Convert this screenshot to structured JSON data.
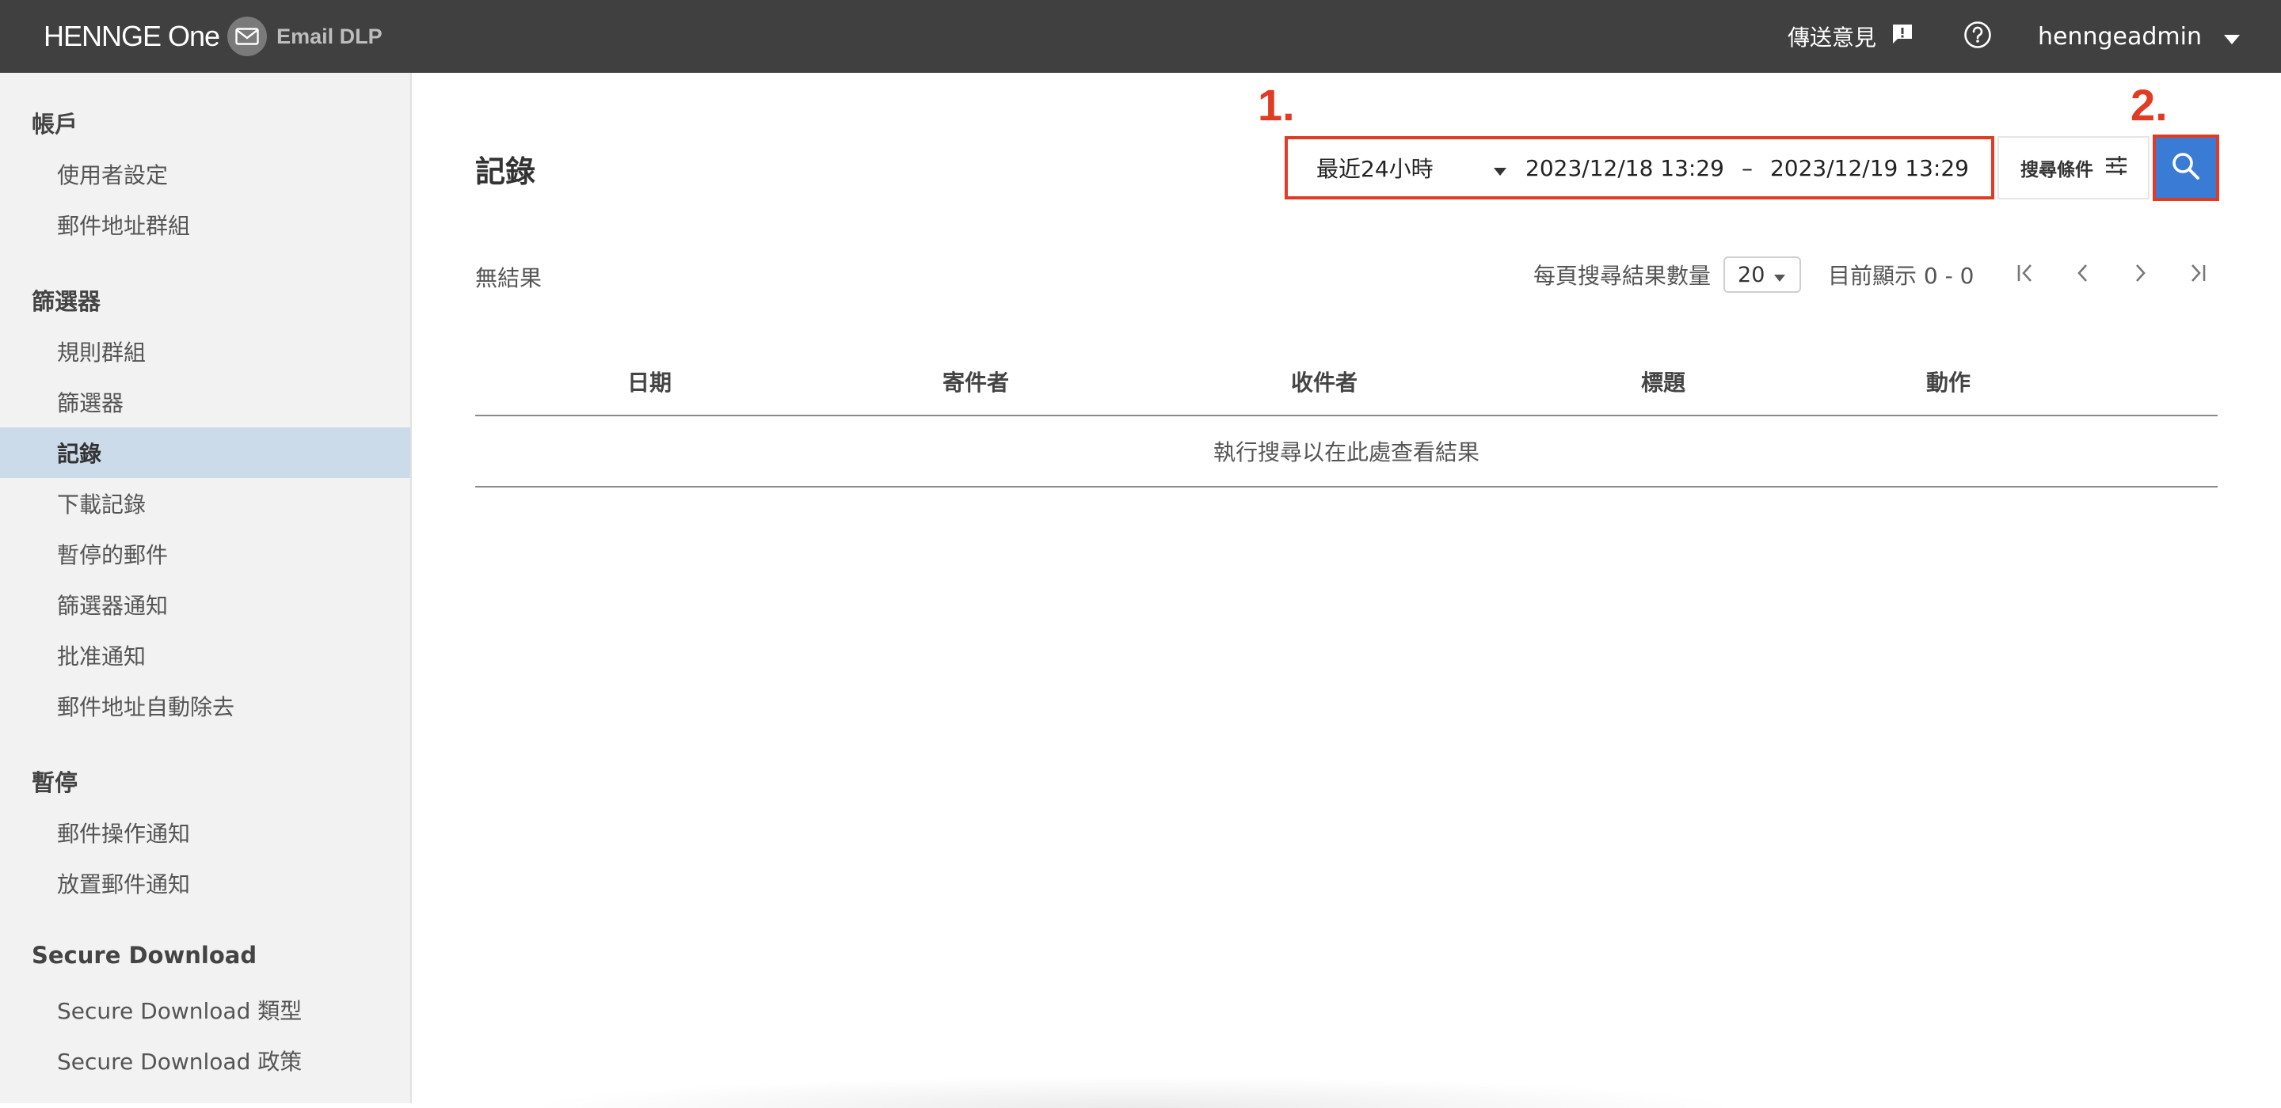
{
  "header": {
    "brand": "HENNGE One",
    "product": "Email DLP",
    "feedback_label": "傳送意見",
    "username": "henngeadmin",
    "icons": {
      "feedback": "feedback-icon",
      "help": "help-icon",
      "caret": "caret-down-icon",
      "logo": "envelope-icon"
    }
  },
  "sidebar": {
    "sections": [
      {
        "title": "帳戶",
        "items": [
          "使用者設定",
          "郵件地址群組"
        ]
      },
      {
        "title": "篩選器",
        "items": [
          "規則群組",
          "篩選器",
          "記錄",
          "下載記錄",
          "暫停的郵件",
          "篩選器通知",
          "批准通知",
          "郵件地址自動除去"
        ]
      },
      {
        "title": "暫停",
        "items": [
          "郵件操作通知",
          "放置郵件通知"
        ]
      },
      {
        "title": "Secure Download",
        "items": [
          "Secure Download 類型",
          "Secure Download 政策"
        ]
      }
    ],
    "active_item": "記錄"
  },
  "main": {
    "title": "記錄",
    "annotations": {
      "one": "1.",
      "two": "2."
    },
    "range": {
      "selected": "最近24小時",
      "from": "2023/12/18  13:29",
      "separator": "–",
      "to": "2023/12/19  13:29"
    },
    "search_conditions_label": "搜尋條件",
    "no_results": "無結果",
    "pager": {
      "per_page_label": "每頁搜尋結果數量",
      "per_page_value": "20",
      "showing": "目前顯示 0 - 0"
    },
    "table": {
      "columns": [
        "日期",
        "寄件者",
        "收件者",
        "標題",
        "動作"
      ],
      "empty_message": "執行搜尋以在此處查看結果"
    }
  },
  "colors": {
    "topbar": "#404040",
    "accent": "#3a7bd5",
    "highlight": "#e03c24",
    "active_nav": "#ccdbe9"
  }
}
